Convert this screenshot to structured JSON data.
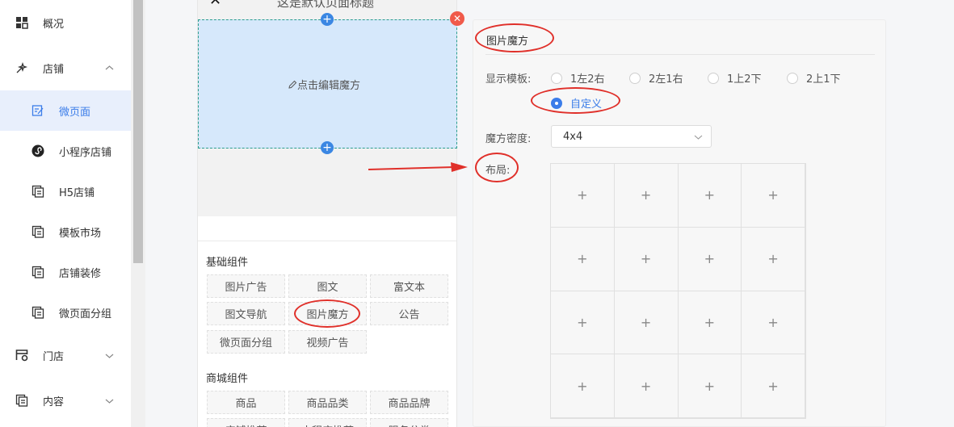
{
  "sidebar": {
    "items": [
      {
        "label": "概况",
        "icon": "dashboard-icon"
      },
      {
        "label": "店铺",
        "icon": "shop-icon",
        "chevron": "^"
      },
      {
        "label": "门店",
        "icon": "store-settings-icon",
        "chevron": "v"
      },
      {
        "label": "内容",
        "icon": "content-icon",
        "chevron": "v"
      }
    ],
    "sub_items": [
      {
        "label": "微页面",
        "icon": "edit-page-icon",
        "active": true
      },
      {
        "label": "小程序店铺",
        "icon": "miniprogram-icon"
      },
      {
        "label": "H5店铺",
        "icon": "h5-icon"
      },
      {
        "label": "模板市场",
        "icon": "template-icon"
      },
      {
        "label": "店铺装修",
        "icon": "decoration-icon"
      },
      {
        "label": "微页面分组",
        "icon": "page-group-icon"
      }
    ]
  },
  "phone": {
    "title": "这是默认页面标题",
    "close_glyph": "✕",
    "more_glyph": "•••",
    "edit_hint": "点击编辑魔方"
  },
  "library": {
    "basic_title": "基础组件",
    "basic": [
      "图片广告",
      "图文",
      "富文本",
      "图文导航",
      "图片魔方",
      "公告",
      "微页面分组",
      "视频广告"
    ],
    "mall_title": "商城组件",
    "mall": [
      "商品",
      "商品品类",
      "商品品牌",
      "店铺推荐",
      "小程序推荐",
      "服务分类"
    ]
  },
  "panel": {
    "title": "图片魔方",
    "template_label": "显示模板:",
    "templates": [
      "1左2右",
      "2左1右",
      "1上2下",
      "2上1下",
      "自定义"
    ],
    "selected_template": "自定义",
    "density_label": "魔方密度:",
    "density_value": "4x4",
    "layout_label": "布局:",
    "grid_rows": 4,
    "grid_cols": 4
  },
  "colors": {
    "accent": "#3b7de9",
    "annotation": "#e0302a",
    "cube_bg": "#d6e8fb"
  }
}
